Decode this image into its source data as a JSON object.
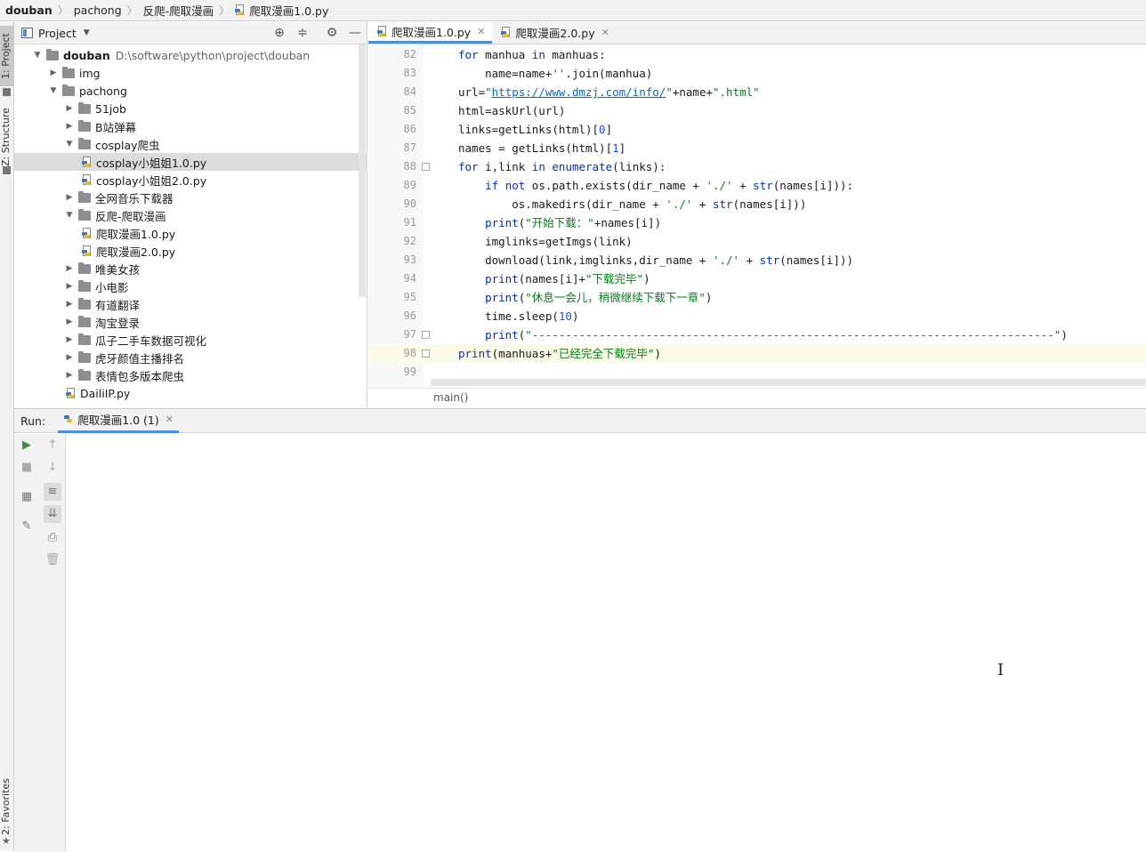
{
  "breadcrumb": {
    "project": "douban",
    "items": [
      "pachong",
      "反爬-爬取漫画"
    ],
    "file": "爬取漫画1.0.py"
  },
  "left_strip": {
    "project_tab": "1: Project",
    "structure_tab": "Z: Structure",
    "favorites_tab": "2: Favorites"
  },
  "project_panel": {
    "title": "Project",
    "tree": [
      {
        "label": "douban",
        "path": "D:\\software\\python\\project\\douban",
        "depth": 0,
        "type": "folder",
        "expanded": true,
        "bold": true
      },
      {
        "label": "img",
        "depth": 1,
        "type": "folder",
        "expanded": false
      },
      {
        "label": "pachong",
        "depth": 1,
        "type": "folder",
        "expanded": true
      },
      {
        "label": "51job",
        "depth": 2,
        "type": "folder",
        "expanded": false
      },
      {
        "label": "B站弹幕",
        "depth": 2,
        "type": "folder",
        "expanded": false
      },
      {
        "label": "cosplay爬虫",
        "depth": 2,
        "type": "folder",
        "expanded": true
      },
      {
        "label": "cosplay小姐姐1.0.py",
        "depth": 3,
        "type": "py",
        "selected": true
      },
      {
        "label": "cosplay小姐姐2.0.py",
        "depth": 3,
        "type": "py"
      },
      {
        "label": "全网音乐下载器",
        "depth": 2,
        "type": "folder",
        "expanded": false
      },
      {
        "label": "反爬-爬取漫画",
        "depth": 2,
        "type": "folder",
        "expanded": true
      },
      {
        "label": "爬取漫画1.0.py",
        "depth": 3,
        "type": "py"
      },
      {
        "label": "爬取漫画2.0.py",
        "depth": 3,
        "type": "py"
      },
      {
        "label": "唯美女孩",
        "depth": 2,
        "type": "folder",
        "expanded": false
      },
      {
        "label": "小电影",
        "depth": 2,
        "type": "folder",
        "expanded": false
      },
      {
        "label": "有道翻译",
        "depth": 2,
        "type": "folder",
        "expanded": false
      },
      {
        "label": "淘宝登录",
        "depth": 2,
        "type": "folder",
        "expanded": false
      },
      {
        "label": "瓜子二手车数据可视化",
        "depth": 2,
        "type": "folder",
        "expanded": false
      },
      {
        "label": "虎牙颜值主播排名",
        "depth": 2,
        "type": "folder",
        "expanded": false
      },
      {
        "label": "表情包多版本爬虫",
        "depth": 2,
        "type": "folder",
        "expanded": false
      },
      {
        "label": "DailiIP.py",
        "depth": 2,
        "type": "py"
      }
    ]
  },
  "editor": {
    "tabs": [
      {
        "label": "爬取漫画1.0.py",
        "active": true
      },
      {
        "label": "爬取漫画2.0.py",
        "active": false
      }
    ],
    "current_line": 98,
    "lines": [
      {
        "n": 82,
        "text": "    for manhua in manhuas:"
      },
      {
        "n": 83,
        "text": "        name=name+''.join(manhua)"
      },
      {
        "n": 84,
        "text": "    url=\"https://www.dmzj.com/info/\"+name+\".html\""
      },
      {
        "n": 85,
        "text": "    html=askUrl(url)"
      },
      {
        "n": 86,
        "text": "    links=getLinks(html)[0]"
      },
      {
        "n": 87,
        "text": "    names = getLinks(html)[1]"
      },
      {
        "n": 88,
        "text": "    for i,link in enumerate(links):"
      },
      {
        "n": 89,
        "text": "        if not os.path.exists(dir_name + './' + str(names[i])):"
      },
      {
        "n": 90,
        "text": "            os.makedirs(dir_name + './' + str(names[i]))"
      },
      {
        "n": 91,
        "text": "        print(\"开始下载：\"+names[i])"
      },
      {
        "n": 92,
        "text": "        imglinks=getImgs(link)"
      },
      {
        "n": 93,
        "text": "        download(link,imglinks,dir_name + './' + str(names[i]))"
      },
      {
        "n": 94,
        "text": "        print(names[i]+\"下载完毕\")"
      },
      {
        "n": 95,
        "text": "        print(\"休息一会儿，稍微继续下载下一章\")"
      },
      {
        "n": 96,
        "text": "        time.sleep(10)"
      },
      {
        "n": 97,
        "text": "        print(\"------------------------------------------------------------------------------\")"
      },
      {
        "n": 98,
        "text": "    print(manhuas+\"已经完全下载完毕\")"
      },
      {
        "n": 99,
        "text": ""
      }
    ],
    "function_breadcrumb": "main()"
  },
  "run_panel": {
    "label": "Run:",
    "tab_label": "爬取漫画1.0 (1)",
    "console_text": ""
  },
  "colors": {
    "accent": "#4a8fd9",
    "keyword": "#0033b3",
    "string": "#067d17",
    "number": "#1750eb",
    "link": "#006dcc",
    "current_line_bg": "#fcfae8",
    "selected_row_bg": "#dcdcdc"
  }
}
